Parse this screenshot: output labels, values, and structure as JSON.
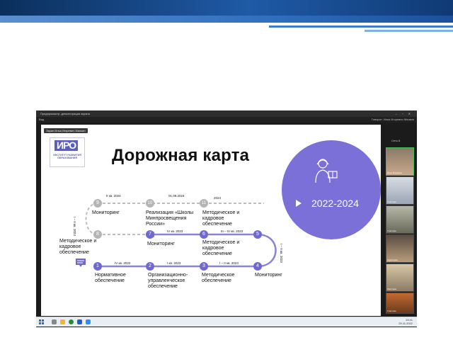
{
  "window": {
    "title": "Предпросмотр: демонстрация экрана",
    "toolbar_left": "Вид",
    "toolbar_right": "Говорит: Илья Игоревич Малкин",
    "controls": "– ▫ ✕"
  },
  "speaker_tag": "Экран Илья Игоревич Малкин",
  "logo": {
    "mark": "ИРО",
    "sub": "ИНСТИТУТ РАЗВИТИЯ ОБРАЗОВАНИЯ"
  },
  "slide": {
    "title": "Дорожная карта",
    "years": "2022-2024"
  },
  "roadmap": {
    "nodes": [
      {
        "n": "1",
        "label": "Нормативное обеспечение",
        "date": "IV кв. 2022"
      },
      {
        "n": "2",
        "label": "Организационно-управленческое обеспечение",
        "date": "I кв. 2023"
      },
      {
        "n": "3",
        "label": "Методическое обеспечение",
        "date": "I – II кв. 2023"
      },
      {
        "n": "4",
        "label": "Мониторинг",
        "date": ""
      },
      {
        "n": "5",
        "label": "",
        "date": "I – II кв. 2023"
      },
      {
        "n": "6",
        "label": "Методическое и кадровое обеспечение",
        "date": "III – IV кв. 2023"
      },
      {
        "n": "7",
        "label": "Мониторинг",
        "date": "IV кв. 2023"
      },
      {
        "n": "8",
        "label": "Методическое и кадровое обеспечение",
        "date": "I – II кв. 2024"
      },
      {
        "n": "9",
        "label": "Мониторинг",
        "date": "II кв. 2024"
      },
      {
        "n": "10",
        "label": "Реализация «Школы Минпросвещения России»",
        "date": "01.09.2024"
      },
      {
        "n": "11",
        "label": "Методическое и кадровое обеспечение",
        "date": "2024"
      }
    ]
  },
  "sidebar": {
    "header": "Сеть 8",
    "participants": [
      "Илья Игоревич",
      "Участник",
      "Участник",
      "Аудитория",
      "Кристина",
      "Участник",
      "Участник"
    ]
  },
  "taskbar": {
    "time": "13:41",
    "date": "29.11.2022"
  },
  "colors": {
    "accent": "#7b6fd8",
    "road": "#8a84d6",
    "node": "#6f68d1"
  }
}
